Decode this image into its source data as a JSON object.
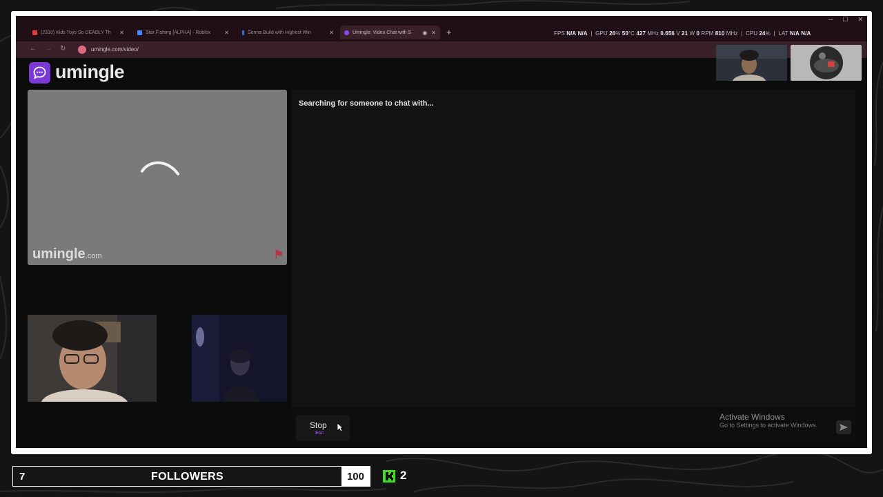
{
  "browser": {
    "tabs": [
      {
        "title": "(2310) Kids Toys So DEADLY Th",
        "favicon_color": "#e23b3b"
      },
      {
        "title": "Star Fishing [ALPHA] - Roblox",
        "favicon_color": "#4a86ff"
      },
      {
        "title": "Senna Build with Highest Win",
        "favicon_color": "#3a6fd8"
      },
      {
        "title": "Umingle: Video Chat with S",
        "favicon_color": "#8a4cf0"
      }
    ],
    "new_tab_symbol": "+",
    "url": "umingle.com/video/"
  },
  "overlay_stats": {
    "fps_label": "FPS",
    "fps_value_1": "N/A",
    "fps_value_2": "N/A",
    "gpu_label": "GPU",
    "gpu_load": "26",
    "gpu_temp": "50",
    "gpu_clock": "427",
    "gpu_volt": "0.656",
    "gpu_power": "21",
    "gpu_fan": "0",
    "gpu_mem": "810",
    "cpu_label": "CPU",
    "cpu_load": "24",
    "lat_label": "LAT",
    "lat_value_1": "N/A",
    "lat_value_2": "N/A"
  },
  "site": {
    "logo_text": "umingle",
    "watermark_main": "umingle",
    "watermark_tld": ".com",
    "status_message": "Searching for someone to chat with...",
    "stop_label": "Stop",
    "stop_hint": "Esc"
  },
  "windows_watermark": {
    "title": "Activate Windows",
    "subtitle": "Go to Settings to activate Windows."
  },
  "stream_bar": {
    "followers_current": "7",
    "followers_label": "FOLLOWERS",
    "followers_goal": "100",
    "kick_count": "2",
    "kick_color": "#3cdd1f"
  },
  "icons": [
    "chat-bubble-icon",
    "back-arrow-icon",
    "forward-arrow-icon",
    "reload-icon",
    "site-info-icon",
    "loading-spinner-icon",
    "send-icon",
    "kick-logo-icon",
    "minimize-icon",
    "maximize-icon",
    "window-close-icon"
  ]
}
